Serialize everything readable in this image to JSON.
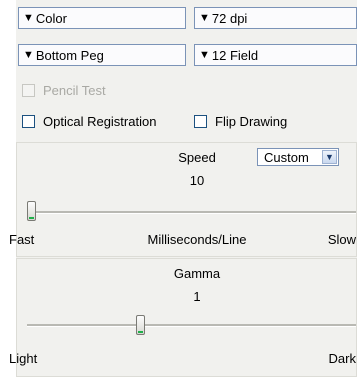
{
  "dropdowns": {
    "color_mode": "Color",
    "resolution": "72 dpi",
    "peg": "Bottom Peg",
    "field": "12 Field"
  },
  "options": {
    "pencil_test": {
      "label": "Pencil Test",
      "checked": false,
      "enabled": false
    },
    "optical_registration": {
      "label": "Optical Registration",
      "checked": false,
      "enabled": true
    },
    "flip_drawing": {
      "label": "Flip Drawing",
      "checked": false,
      "enabled": true
    }
  },
  "speed": {
    "label": "Speed",
    "value": "10",
    "preset": "Custom",
    "min_label": "Fast",
    "units_label": "Milliseconds/Line",
    "max_label": "Slow",
    "slider_position": 0.0
  },
  "gamma": {
    "label": "Gamma",
    "value": "1",
    "min_label": "Light",
    "max_label": "Dark",
    "slider_position": 0.34
  },
  "colors": {
    "panel_bg": "#f1f1ee",
    "control_border": "#7b93b7",
    "slider_accent": "#1fb04a"
  }
}
